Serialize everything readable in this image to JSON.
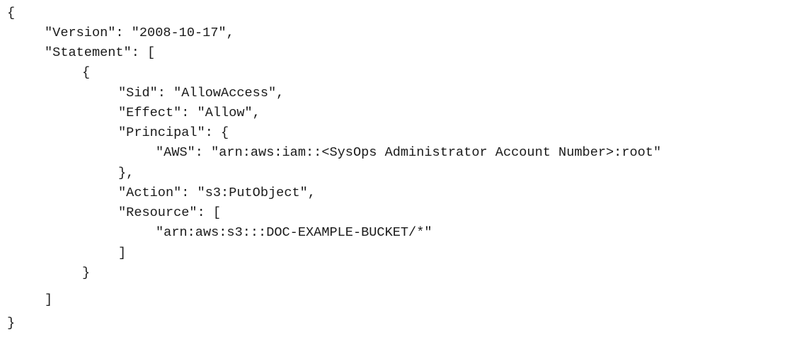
{
  "code_lines": [
    "{",
    "\"Version\": \"2008-10-17\",",
    "\"Statement\": [",
    "{",
    "\"Sid\": \"AllowAccess\",",
    "\"Effect\": \"Allow\",",
    "\"Principal\": {",
    "\"AWS\": \"arn:aws:iam::<SysOps Administrator Account Number>:root\"",
    "},",
    "\"Action\": \"s3:PutObject\",",
    "\"Resource\": [",
    "\"arn:aws:s3:::DOC-EXAMPLE-BUCKET/*\"",
    "]",
    "}",
    "]",
    "}"
  ]
}
